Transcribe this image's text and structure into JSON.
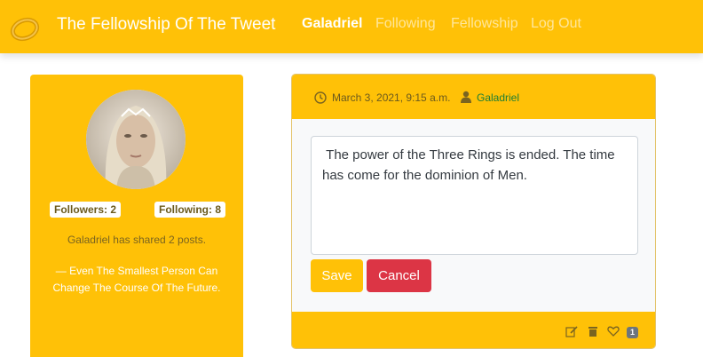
{
  "nav": {
    "brand": "The Fellowship Of The Tweet",
    "links": [
      "Galadriel",
      "Following",
      "Fellowship",
      "Log Out"
    ],
    "active": "Galadriel"
  },
  "profile": {
    "followers_label": "Followers: 2",
    "following_label": "Following: 8",
    "shared_text": "Galadriel has shared 2 posts.",
    "motto": "— Even The Smallest Person Can Change The Course Of The Future."
  },
  "post": {
    "date": "March 3, 2021, 9:15 a.m.",
    "author": "Galadriel",
    "content": " The power of the Three Rings is ended. The time has come for the dominion of Men.",
    "save_label": "Save",
    "cancel_label": "Cancel",
    "like_count": "1"
  },
  "colors": {
    "accent": "#ffc107",
    "danger": "#dc3545",
    "author_link": "#1e7e34"
  },
  "icons": [
    "ring-logo-icon",
    "clock-icon",
    "user-icon",
    "edit-icon",
    "trash-icon",
    "heart-icon"
  ]
}
